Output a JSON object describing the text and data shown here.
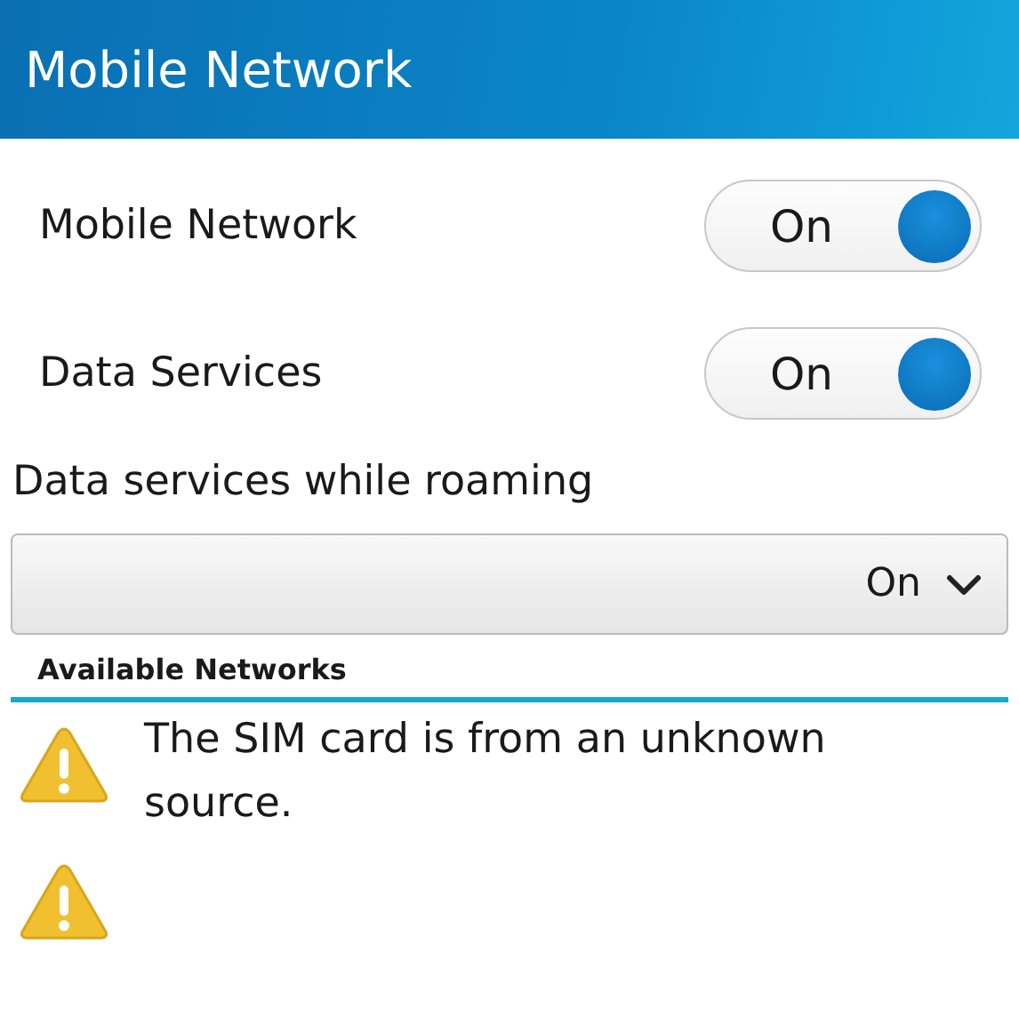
{
  "header": {
    "title": "Mobile Network"
  },
  "toggles": [
    {
      "label": "Mobile Network",
      "on": true,
      "state_text": "On"
    },
    {
      "label": "Data Services",
      "on": true,
      "state_text": "On"
    }
  ],
  "roaming": {
    "label": "Data services while roaming",
    "value": "On"
  },
  "available_networks": {
    "heading": "Available Networks",
    "items": [
      {
        "kind": "warning",
        "message": "The SIM card is from an unknown source."
      },
      {
        "kind": "warning"
      }
    ]
  }
}
